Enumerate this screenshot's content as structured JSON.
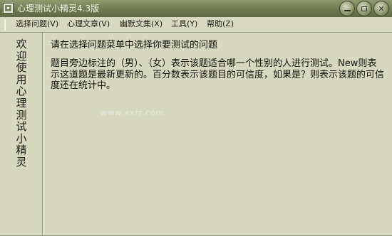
{
  "window": {
    "title": "心理测试小精灵4.3版",
    "min_icon": "minimize-icon",
    "max_icon": "maximize-icon",
    "close_icon": "close-icon"
  },
  "menu": {
    "items": [
      {
        "label": "选择问题(V)"
      },
      {
        "label": "心理文章(V)"
      },
      {
        "label": "幽默文集(X)"
      },
      {
        "label": "工具(Y)"
      },
      {
        "label": "帮助(Z)"
      }
    ]
  },
  "sidebar": {
    "text": "欢迎使用心理测试小精灵"
  },
  "content": {
    "heading": "请在选择问题菜单中选择你要测试的问题",
    "paragraph": "题目旁边标注的（男）、（女）表示该题适合哪一个性别的人进行测试。New则表示这道题是最新更新的。百分数表示该题目的可信度，如果是？则表示该题的可信度还在统计中。",
    "watermark": "www.xxrr.com"
  },
  "colors": {
    "titlebar": "#6f7a50",
    "background": "#d6d8bf",
    "text": "#111108"
  }
}
